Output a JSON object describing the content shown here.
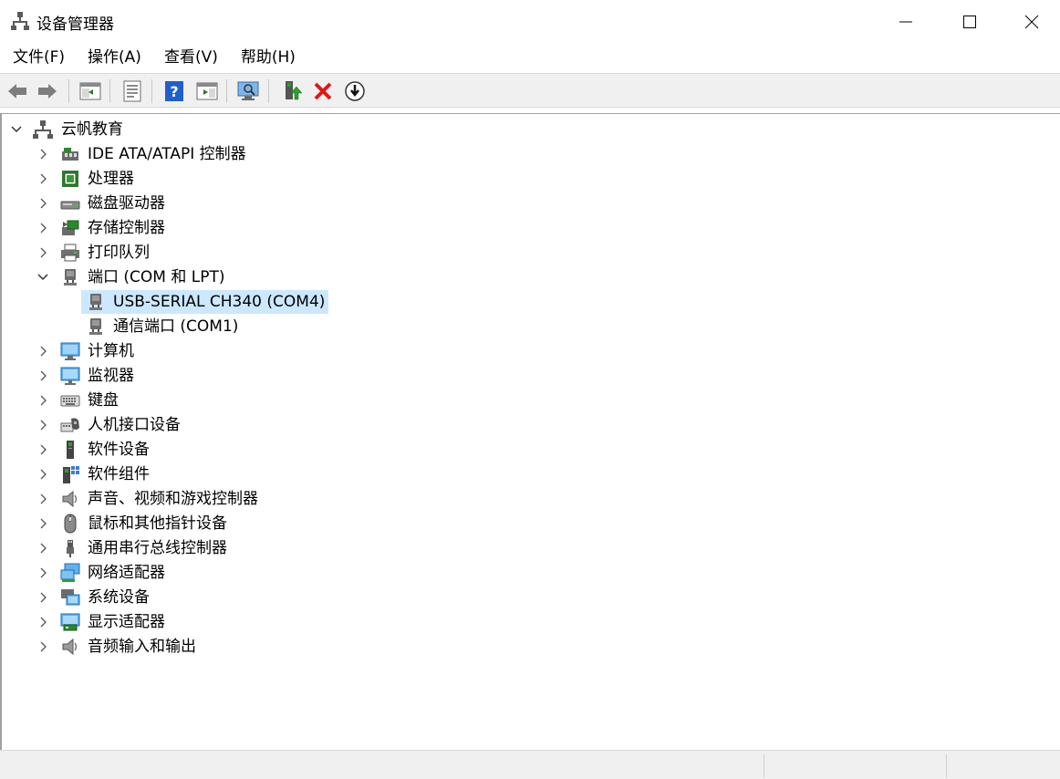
{
  "window": {
    "title": "设备管理器"
  },
  "menu": [
    "文件(F)",
    "操作(A)",
    "查看(V)",
    "帮助(H)"
  ],
  "toolbar": {
    "buttons": [
      {
        "name": "back-icon"
      },
      {
        "name": "forward-icon"
      },
      {
        "name": "show-hide-console-tree-icon"
      },
      {
        "name": "properties-icon"
      },
      {
        "name": "help-icon"
      },
      {
        "name": "action-pane-icon"
      },
      {
        "name": "scan-hardware-icon"
      },
      {
        "name": "update-driver-icon"
      },
      {
        "name": "uninstall-device-icon"
      },
      {
        "name": "disable-device-icon"
      }
    ]
  },
  "tree": {
    "root": "云帆教育",
    "items": [
      {
        "label": "IDE ATA/ATAPI 控制器",
        "icon": "ide-controller-icon",
        "expanded": false
      },
      {
        "label": "处理器",
        "icon": "processor-icon",
        "expanded": false
      },
      {
        "label": "磁盘驱动器",
        "icon": "disk-drive-icon",
        "expanded": false
      },
      {
        "label": "存储控制器",
        "icon": "storage-controller-icon",
        "expanded": false
      },
      {
        "label": "打印队列",
        "icon": "printer-icon",
        "expanded": false
      },
      {
        "label": "端口 (COM 和 LPT)",
        "icon": "port-icon",
        "expanded": true,
        "children": [
          {
            "label": "USB-SERIAL CH340 (COM4)",
            "icon": "port-icon",
            "selected": true
          },
          {
            "label": "通信端口 (COM1)",
            "icon": "port-icon",
            "selected": false
          }
        ]
      },
      {
        "label": "计算机",
        "icon": "computer-icon",
        "expanded": false
      },
      {
        "label": "监视器",
        "icon": "monitor-icon",
        "expanded": false
      },
      {
        "label": "键盘",
        "icon": "keyboard-icon",
        "expanded": false
      },
      {
        "label": "人机接口设备",
        "icon": "hid-icon",
        "expanded": false
      },
      {
        "label": "软件设备",
        "icon": "software-device-icon",
        "expanded": false
      },
      {
        "label": "软件组件",
        "icon": "software-component-icon",
        "expanded": false
      },
      {
        "label": "声音、视频和游戏控制器",
        "icon": "speaker-icon",
        "expanded": false
      },
      {
        "label": "鼠标和其他指针设备",
        "icon": "mouse-icon",
        "expanded": false
      },
      {
        "label": "通用串行总线控制器",
        "icon": "usb-icon",
        "expanded": false
      },
      {
        "label": "网络适配器",
        "icon": "network-adapter-icon",
        "expanded": false
      },
      {
        "label": "系统设备",
        "icon": "system-device-icon",
        "expanded": false
      },
      {
        "label": "显示适配器",
        "icon": "display-adapter-icon",
        "expanded": false
      },
      {
        "label": "音频输入和输出",
        "icon": "audio-io-icon",
        "expanded": false
      }
    ]
  },
  "colors": {
    "selection": "#cce8ff",
    "toolbar_bg": "#f0f0f0"
  }
}
